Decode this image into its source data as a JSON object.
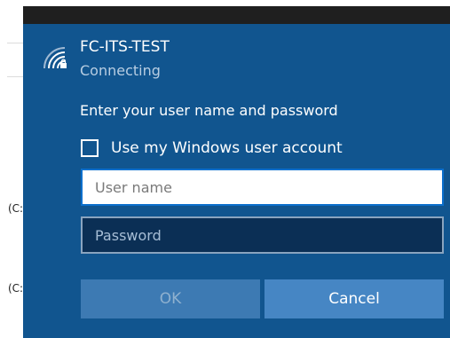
{
  "background": {
    "fragment_1": "(C:",
    "fragment_2": "(C:"
  },
  "network": {
    "icon": "wifi-secure-icon",
    "name": "FC-ITS-TEST",
    "status": "Connecting"
  },
  "prompt": "Enter your user name and password",
  "checkbox": {
    "label": "Use my Windows user account",
    "checked": false
  },
  "fields": {
    "username_placeholder": "User name",
    "username_value": "",
    "password_placeholder": "Password",
    "password_value": ""
  },
  "buttons": {
    "ok_label": "OK",
    "ok_enabled": false,
    "cancel_label": "Cancel"
  },
  "colors": {
    "panel": "#11558f",
    "input_focus_border": "#0b6fcc",
    "button": "#4686c4"
  }
}
